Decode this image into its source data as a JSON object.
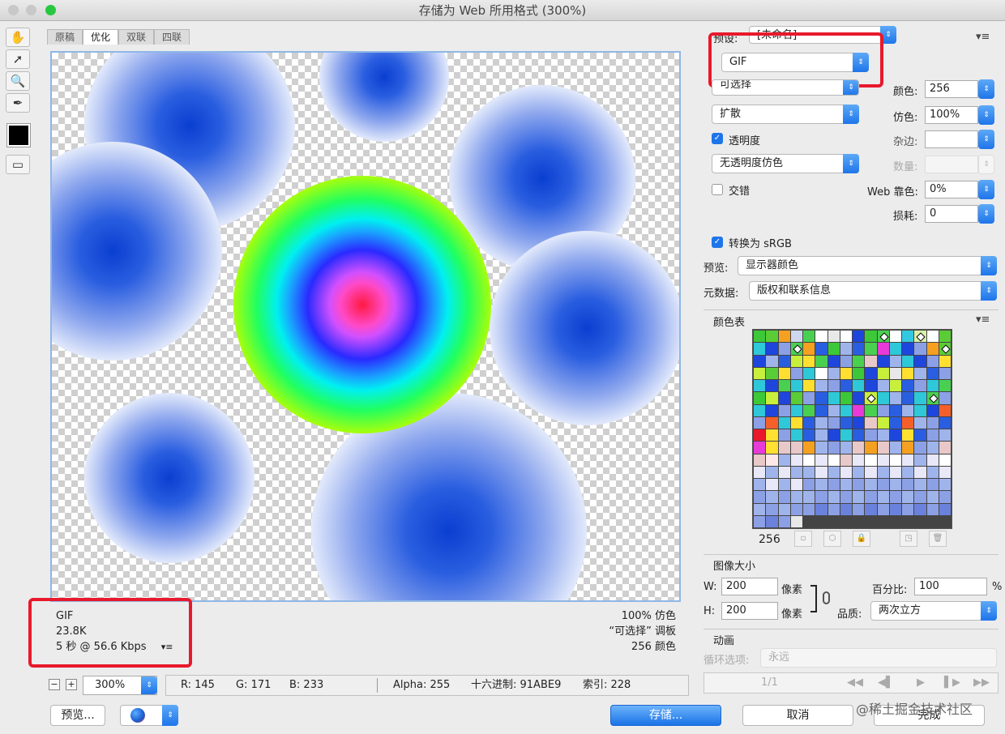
{
  "window": {
    "title": "存储为 Web 所用格式 (300%)"
  },
  "tools": [
    "hand-tool-icon",
    "slice-select-icon",
    "zoom-tool-icon",
    "eyedropper-icon"
  ],
  "tabs": [
    {
      "label": "原稿",
      "active": false
    },
    {
      "label": "优化",
      "active": true
    },
    {
      "label": "双联",
      "active": false
    },
    {
      "label": "四联",
      "active": false
    }
  ],
  "image_info": {
    "format": "GIF",
    "size": "23.8K",
    "time": "5 秒 @ 56.6 Kbps",
    "dither_pct": "100% 仿色",
    "palette": "“可选择” 调板",
    "colors_count": "256 颜色"
  },
  "bottom": {
    "zoom": "300%",
    "r": "R: 145",
    "g": "G: 171",
    "b": "B: 233",
    "alpha": "Alpha: 255",
    "hex": "十六进制: 91ABE9",
    "index": "索引: 228"
  },
  "buttons": {
    "preview": "预览...",
    "save": "存储...",
    "cancel": "取消",
    "done": "完成"
  },
  "settings": {
    "preset_label": "预设:",
    "preset_value": "[未命名]",
    "format": "GIF",
    "reduction": "可选择",
    "dither_algo": "扩散",
    "transparency_label": "透明度",
    "transparency_checked": true,
    "transparency_dither": "无透明度仿色",
    "interlaced_label": "交错",
    "interlaced_checked": false,
    "colors_label": "颜色:",
    "colors_value": "256",
    "dither_label": "仿色:",
    "dither_value": "100%",
    "matte_label": "杂边:",
    "amount_label": "数量:",
    "websnap_label": "Web 靠色:",
    "websnap_value": "0%",
    "lossy_label": "损耗:",
    "lossy_value": "0",
    "srgb_label": "转换为 sRGB",
    "srgb_checked": true,
    "preview_label": "预览:",
    "preview_value": "显示器颜色",
    "metadata_label": "元数据:",
    "metadata_value": "版权和联系信息"
  },
  "color_table": {
    "title": "颜色表",
    "count": "256",
    "colors": [
      "#3cc838",
      "#5acd36",
      "#f5a020",
      "#cdd7f0",
      "#4ad050",
      "#ffffff",
      "#e8e8e8",
      "#ffffff",
      "#1e46dc",
      "#3cc838",
      "#4ad050",
      "#ffffff",
      "#34c8e0",
      "#d8f0a8",
      "#ffffff",
      "#5acd36",
      "#2ec8d8",
      "#1e46dc",
      "#8ca0e6",
      "#4ad050",
      "#f5a020",
      "#2a5ee0",
      "#3cc838",
      "#a0b4ec",
      "#2a5ee0",
      "#4ad050",
      "#e83ad8",
      "#2ec8d8",
      "#1e46dc",
      "#8ca0e6",
      "#f5a020",
      "#5acd36",
      "#1e46dc",
      "#a0b4ec",
      "#2a5ee0",
      "#c8ef3c",
      "#ffe030",
      "#4ad050",
      "#1e46dc",
      "#8ca0e6",
      "#4ad050",
      "#e8c8c8",
      "#1e46dc",
      "#a0b4ec",
      "#2ec8d8",
      "#1e46dc",
      "#8ca0e6",
      "#ffe030",
      "#c8ef3c",
      "#5acd36",
      "#ffe030",
      "#8ca0e6",
      "#2ec8d8",
      "#ffffff",
      "#a0b4ec",
      "#ffe030",
      "#3cc838",
      "#1e46dc",
      "#c8ef3c",
      "#e8e8e8",
      "#ffe030",
      "#a0b4ec",
      "#2a5ee0",
      "#8ca0e6",
      "#2ec8d8",
      "#1e46dc",
      "#4ad050",
      "#2ec8d8",
      "#ffe030",
      "#a0b4ec",
      "#8ca0e6",
      "#2a5ee0",
      "#2ec8d8",
      "#1e46dc",
      "#a0b4ec",
      "#c8ef3c",
      "#2a5ee0",
      "#8ca0e6",
      "#2ec8d8",
      "#4ad050",
      "#3cc838",
      "#c8ef3c",
      "#1e46dc",
      "#5acd36",
      "#8ca0e6",
      "#2a5ee0",
      "#2ec8d8",
      "#3cc838",
      "#1e46dc",
      "#c8ef3c",
      "#2ec8d8",
      "#a0b4ec",
      "#2a5ee0",
      "#2ec8d8",
      "#4ad050",
      "#8ca0e6",
      "#2ec8d8",
      "#1e46dc",
      "#8ca0e6",
      "#2ec8d8",
      "#4ad050",
      "#2a5ee0",
      "#a0b4ec",
      "#2ec8d8",
      "#e83ad8",
      "#4ad050",
      "#8ca0e6",
      "#2a5ee0",
      "#a0b4ec",
      "#2ec8d8",
      "#1e46dc",
      "#f5602a",
      "#8ca0e6",
      "#f5602a",
      "#2ec8d8",
      "#ffe030",
      "#2a5ee0",
      "#a0b4ec",
      "#8ca0e6",
      "#2a5ee0",
      "#1e46dc",
      "#e8c8c8",
      "#c8ef3c",
      "#2a5ee0",
      "#f5602a",
      "#a0b4ec",
      "#8ca0e6",
      "#2a5ee0",
      "#e8192c",
      "#ffe030",
      "#8ca0e6",
      "#2ec8d8",
      "#2a5ee0",
      "#a0b4ec",
      "#1e46dc",
      "#2ec8d8",
      "#2a5ee0",
      "#8ca0e6",
      "#a0b4ec",
      "#1e46dc",
      "#ffe030",
      "#2a5ee0",
      "#8ca0e6",
      "#a0b4ec",
      "#e83ad8",
      "#ffe030",
      "#e8c8c8",
      "#e8c8c8",
      "#f5a020",
      "#a0b4ec",
      "#8ca0e6",
      "#a0b4ec",
      "#e8c8c8",
      "#f5a020",
      "#e8c8c8",
      "#a0b4ec",
      "#f5a020",
      "#8ca0e6",
      "#a0b4ec",
      "#e8c8c8",
      "#e8c8c8",
      "#ffe8e8",
      "#a0b4ec",
      "#e8e8f8",
      "#ffffff",
      "#e8e8f8",
      "#ffffff",
      "#e8c8c8",
      "#e8e8f8",
      "#ffffff",
      "#e8e8f8",
      "#ffffff",
      "#e8e8f8",
      "#a0b4ec",
      "#e8e8f8",
      "#ffffff",
      "#e8e8f8",
      "#a0b4ec",
      "#e8e8f8",
      "#a0b4ec",
      "#a0b4ec",
      "#e8e8f8",
      "#a0b4ec",
      "#e8e8f8",
      "#a0b4ec",
      "#e8e8f8",
      "#a0b4ec",
      "#e8e8f8",
      "#a0b4ec",
      "#e8e8f8",
      "#a0b4ec",
      "#e8e8f8",
      "#a0b4ec",
      "#e8e8f8",
      "#a0b4ec",
      "#e8e8f8",
      "#8ca0e6",
      "#a0b4ec",
      "#8ca0e6",
      "#a0b4ec",
      "#8ca0e6",
      "#a0b4ec",
      "#8ca0e6",
      "#a0b4ec",
      "#8ca0e6",
      "#a0b4ec",
      "#8ca0e6",
      "#a0b4ec",
      "#8ca0e6",
      "#a0b4ec",
      "#8ca0e6",
      "#a0b4ec",
      "#a0b4ec",
      "#8ca0e6",
      "#a0b4ec",
      "#8ca0e6",
      "#a0b4ec",
      "#8ca0e6",
      "#a0b4ec",
      "#8ca0e6",
      "#a0b4ec",
      "#8ca0e6",
      "#a0b4ec",
      "#8ca0e6",
      "#a0b4ec",
      "#8ca0e6",
      "#a0b4ec",
      "#8ca0e6",
      "#8ca0e6",
      "#6a82dc",
      "#8ca0e6",
      "#6a82dc",
      "#8ca0e6",
      "#6a82dc",
      "#8ca0e6",
      "#6a82dc",
      "#8ca0e6",
      "#6a82dc",
      "#8ca0e6",
      "#6a82dc",
      "#8ca0e6",
      "#6a82dc",
      "#8ca0e6",
      "#e8e8e8"
    ],
    "marked_indices": [
      10,
      13,
      19,
      31,
      89,
      94
    ]
  },
  "image_size": {
    "title": "图像大小",
    "w_label": "W:",
    "w_value": "200",
    "h_label": "H:",
    "h_value": "200",
    "unit": "像素",
    "percent_label": "百分比:",
    "percent_value": "100",
    "percent_sign": "%",
    "quality_label": "品质:",
    "quality_value": "两次立方"
  },
  "animation": {
    "title": "动画",
    "loop_label": "循环选项:",
    "loop_value": "永远",
    "frame": "1/1"
  },
  "watermark": "@稀土掘金技术社区",
  "colors": {
    "accent": "#1e75ea",
    "highlight": "#e8192c"
  }
}
